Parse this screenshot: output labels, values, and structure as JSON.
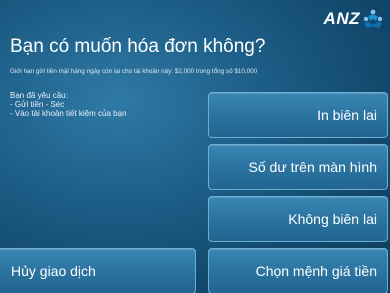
{
  "brand": {
    "name": "ANZ"
  },
  "screen": {
    "title": "Bạn có muốn hóa đơn không?",
    "limit_notice": "Giới hạn gửi tiền mặt hàng ngày còn lại cho tài khoản này: $2,000 trong tổng số $10,000",
    "request": {
      "heading": "Bạn đã yêu cầu:",
      "lines": [
        "- Gửi tiền - Séc",
        "- Vào tài khoản tiết kiệm của bạn"
      ]
    }
  },
  "options": {
    "print_receipt": "In biên lai",
    "on_screen_balance": "Số dư trên màn hình",
    "no_receipt": "Không biên lai",
    "select_denomination": "Chọn mệnh giá tiền",
    "cancel": "Hủy giao dịch"
  },
  "colors": {
    "background": "#1d5e86",
    "button": "#2a729f",
    "button_border": "#6aaed4",
    "text": "#ffffff"
  }
}
